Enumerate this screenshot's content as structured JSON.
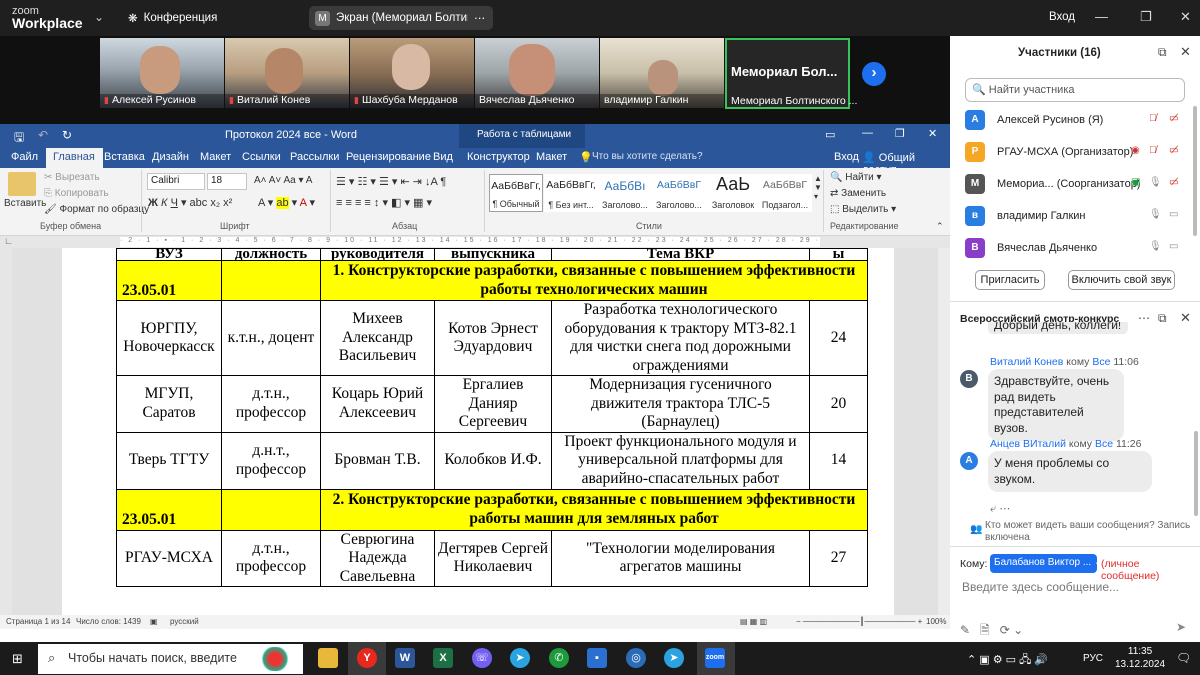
{
  "zoom": {
    "logo_line1": "zoom",
    "logo_line2": "Workplace",
    "meeting_label": "Конференция",
    "screen_share_label": "Экран (Мемориал Болтинского",
    "screen_share_avatar": "M",
    "enter_label": "Вход",
    "participants_strip": [
      {
        "name": "Алексей Русинов",
        "muted": true
      },
      {
        "name": "Виталий Конев",
        "muted": true
      },
      {
        "name": "Шахбуба Мерданов",
        "muted": true
      },
      {
        "name": "Вячеслав Дьяченко",
        "muted": false
      },
      {
        "name": "владимир Галкин",
        "muted": false
      },
      {
        "name": "Мемориал Болтинского ...",
        "big": "Мемориал  Бол...",
        "active": true
      }
    ]
  },
  "word": {
    "title": "Протокол 2024 все - Word",
    "table_tools": "Работа с таблицами",
    "tabs": [
      "Файл",
      "Главная",
      "Вставка",
      "Дизайн",
      "Макет",
      "Ссылки",
      "Рассылки",
      "Рецензирование",
      "Вид",
      "Конструктор",
      "Макет"
    ],
    "tell_me": "Что вы хотите сделать?",
    "sign_in": "Вход",
    "share": "Общий доступ",
    "clipboard": {
      "paste": "Вставить",
      "cut": "Вырезать",
      "copy": "Копировать",
      "format_painter": "Формат по образцу",
      "group": "Буфер обмена"
    },
    "font": {
      "name": "Calibri",
      "size": "18",
      "group": "Шрифт"
    },
    "paragraph_group": "Абзац",
    "styles_group": "Стили",
    "editing_group": "Редактирование",
    "styles": [
      {
        "sample": "АаБбВвГг,",
        "name": "¶ Обычный"
      },
      {
        "sample": "АаБбВвГг,",
        "name": "¶ Без инт..."
      },
      {
        "sample": "АаБбВı",
        "name": "Заголово..."
      },
      {
        "sample": "АаБбВвГ",
        "name": "Заголово..."
      },
      {
        "sample": "АаЬ",
        "name": "Заголовок"
      },
      {
        "sample": "АаБбВвГ",
        "name": "Подзагол..."
      }
    ],
    "editing": {
      "find": "Найти",
      "replace": "Заменить",
      "select": "Выделить"
    },
    "ruler": "· 2 · 1 · ▪ · 1 · 2 · 3 · 4 · 5 · 6 · 7 · 8 · 9 · 10 · 11 · 12 · 13 · 14 · 15 · 16 · 17 · 18 · 19 · 20 · 21 · 22 · 23 · 24 · 25 · 26 · 27 · 28 · 29 ·",
    "status": {
      "page": "Страница 1 из 14",
      "words": "Число слов: 1439",
      "lang": "русский",
      "zoom": "100%"
    },
    "table": {
      "header": [
        "ВУЗ",
        "должность",
        "руководителя",
        "выпускника",
        "Тема ВКР",
        "ы"
      ],
      "sections": [
        {
          "code": "23.05.01",
          "title": "1. Конструкторские разработки, связанные с повышением эффективности работы технологических машин",
          "rows": [
            {
              "vuz": "ЮРГПУ, Новочеркасск",
              "position": "к.т.н., доцент",
              "supervisor": "Михеев Александр Васильевич",
              "graduate": "Котов Эрнест Эдуардович",
              "topic": "Разработка технологического оборудования к трактору МТЗ-82.1 для чистки снега под дорожными ограждениями",
              "pages": "24"
            },
            {
              "vuz": "МГУП, Саратов",
              "position": "д.т.н., профессор",
              "supervisor": "Коцарь Юрий Алексеевич",
              "graduate": "Ергалиев Данияр Сергеевич",
              "topic": "Модернизация гусеничного движителя трактора ТЛС-5 (Барнаулец)",
              "pages": "20"
            },
            {
              "vuz": "Тверь ТГТУ",
              "position": "д.н.т., профессор",
              "supervisor": "Бровман Т.В.",
              "graduate": "Колобков И.Ф.",
              "topic": "Проект функционального модуля и универсальной платформы для аварийно-спасательных работ",
              "pages": "14"
            }
          ]
        },
        {
          "code": "23.05.01",
          "title": "2. Конструкторские разработки, связанные с повышением эффективности работы машин для земляных работ",
          "rows": [
            {
              "vuz": "РГАУ-МСХА",
              "position": "д.т.н., профессор",
              "supervisor": "Севрюгина Надежда Савельевна",
              "graduate": "Дегтярев Сергей Николаевич",
              "topic": "\"Технологии моделирования агрегатов машины",
              "pages": "27"
            }
          ]
        }
      ]
    }
  },
  "participants_panel": {
    "title": "Участники (16)",
    "search_placeholder": "Найти участника",
    "list": [
      {
        "avatar": "А",
        "name": "Алексей Русинов (Я)",
        "color": "#2a7de1"
      },
      {
        "avatar": "Р",
        "name": "РГАУ-МСХА (Организатор)",
        "color": "#f5a623"
      },
      {
        "avatar": "М",
        "name": "Мемориа...  (Соорганизатор)",
        "color": "#555555"
      },
      {
        "avatar": "в",
        "name": "владимир Галкин",
        "color": "#2a7de1"
      },
      {
        "avatar": "В",
        "name": "Вячеслав Дьяченко",
        "color": "#8a3ec8"
      }
    ],
    "invite": "Пригласить",
    "unmute": "Включить свой звук"
  },
  "chat": {
    "title": "Всероссийский смотр-конкурс в...",
    "partial_top": "Добрый день, коллеги!",
    "messages": [
      {
        "avatar": "В",
        "sender": "Виталий Конев",
        "to_word": "кому",
        "to": "Все",
        "time": "11:06",
        "text": "Здравствуйте, очень рад видеть представителей вузов."
      },
      {
        "avatar": "А",
        "sender": "Анцев ВИталий",
        "to_word": "кому",
        "to": "Все",
        "time": "11:26",
        "text": "У меня проблемы со звуком."
      }
    ],
    "privacy_note": "Кто может видеть ваши сообщения? Запись включена",
    "to_label": "Кому:",
    "to_value": "Балабанов Виктор ...",
    "private_label": "(личное сообщение)",
    "input_placeholder": "Введите здесь сообщение..."
  },
  "taskbar": {
    "search_placeholder": "Чтобы начать поиск, введите",
    "lang": "РУС",
    "time": "11:35",
    "date": "13.12.2024"
  }
}
